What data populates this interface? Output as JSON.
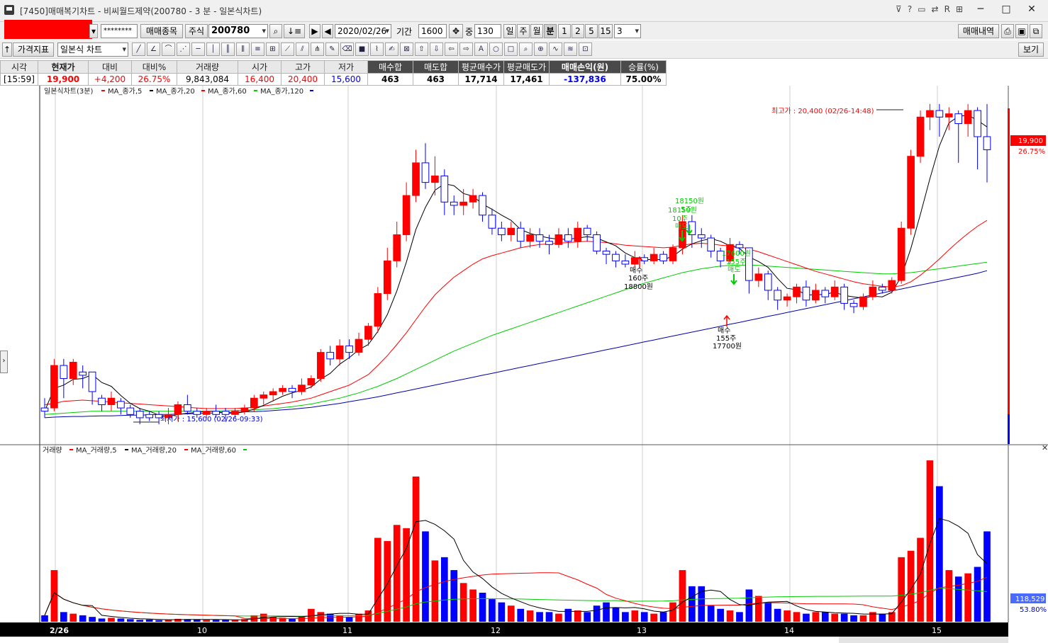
{
  "window": {
    "title": "[7450]매매복기차트 - 비씨월드제약(200780 - 3 분 - 일본식차트)",
    "icons": [
      "?",
      "R"
    ],
    "buttons": [
      "─",
      "□",
      "✕"
    ]
  },
  "toolbar": {
    "account_mask": "********",
    "trade_items_label": "매매종목",
    "market_label": "주식",
    "code": "200780",
    "date": "2020/02/26",
    "period_label": "기간",
    "period_value": "1600",
    "mid_label": "중",
    "mid_value": "130",
    "period_tabs": [
      "일",
      "주",
      "월",
      "분",
      "1",
      "2",
      "5",
      "15"
    ],
    "interval_value": "3",
    "trade_history_label": "매매내역",
    "price_indicator_label": "가격지표",
    "chart_type": "일본식 차트",
    "view_label": "보기"
  },
  "info": {
    "headers": [
      "시각",
      "현재가",
      "대비",
      "대비%",
      "거래량",
      "시가",
      "고가",
      "저가",
      "매수합",
      "매도합",
      "평균매수가",
      "평균매도가",
      "매매손익(원)",
      "승률(%)"
    ],
    "values": [
      "[15:59]",
      "19,900",
      "+4,200",
      "26.75%",
      "9,843,084",
      "16,400",
      "20,400",
      "15,600",
      "463",
      "463",
      "17,714",
      "17,461",
      "-137,836",
      "75.00%"
    ]
  },
  "price_legend": [
    "일본식차트(3분)",
    "MA_종가,5",
    "MA_종가,20",
    "MA_종가,60",
    "MA_종가,120"
  ],
  "volume_legend": [
    "거래량",
    "MA_거래량,5",
    "MA_거래량,20",
    "MA_거래량,60"
  ],
  "annotations": {
    "high": "최고가 : 20,400 (02/26-14:48)",
    "low": "최저가 : 15,600 (02/26-09:33)",
    "buy1": [
      "매수",
      "160주",
      "18800원"
    ],
    "buy2": [
      "매수",
      "155주",
      "17700원"
    ],
    "sell1": [
      "18150원",
      "5주",
      "18150원",
      "10주",
      "매도"
    ],
    "sell2": [
      "17600원",
      "155주",
      "매도"
    ]
  },
  "price_tag": [
    "19,900",
    "26.75%"
  ],
  "volume_tag": [
    "118,529",
    "53.80%"
  ],
  "x_labels": [
    "2/26",
    "10",
    "11",
    "12",
    "13",
    "14",
    "15"
  ],
  "colors": {
    "up": "#ff0000",
    "down": "#0000ff",
    "ma5": "#000000",
    "ma20": "#ff0000",
    "ma60": "#00cc00",
    "ma120": "#0000aa"
  },
  "chart_data": {
    "type": "candlestick",
    "interval": "3분",
    "high": 20400,
    "low": 15600,
    "candles": [
      [
        15750,
        15700,
        15900,
        15600
      ],
      [
        15750,
        16400,
        16500,
        15700
      ],
      [
        16400,
        16200,
        16500,
        15900
      ],
      [
        16200,
        16450,
        16500,
        16100
      ],
      [
        16300,
        16250,
        16400,
        16050
      ],
      [
        16300,
        16000,
        16200,
        15800
      ],
      [
        15900,
        15800,
        15950,
        15700
      ],
      [
        15800,
        15900,
        16000,
        15700
      ],
      [
        15850,
        15750,
        15900,
        15650
      ],
      [
        15750,
        15650,
        15800,
        15600
      ],
      [
        15700,
        15600,
        15750,
        15500
      ],
      [
        15650,
        15600,
        15700,
        15550
      ],
      [
        15650,
        15600,
        15700,
        15500
      ],
      [
        15600,
        15650,
        15750,
        15500
      ],
      [
        15650,
        15800,
        15850,
        15550
      ],
      [
        15800,
        15700,
        15950,
        15650
      ],
      [
        15700,
        15650,
        15750,
        15600
      ],
      [
        15650,
        15700,
        15750,
        15600
      ],
      [
        15700,
        15650,
        15800,
        15600
      ],
      [
        15700,
        15650,
        15750,
        15550
      ],
      [
        15650,
        15700,
        15750,
        15600
      ],
      [
        15700,
        15750,
        15800,
        15650
      ],
      [
        15750,
        15900,
        15950,
        15700
      ],
      [
        15900,
        15950,
        16000,
        15800
      ],
      [
        15950,
        16000,
        16050,
        15850
      ],
      [
        16000,
        16050,
        16100,
        15950
      ],
      [
        16050,
        16000,
        16100,
        15900
      ],
      [
        16000,
        16100,
        16200,
        15950
      ],
      [
        16100,
        16200,
        16250,
        16050
      ],
      [
        16200,
        16600,
        16650,
        16150
      ],
      [
        16600,
        16500,
        16700,
        16400
      ],
      [
        16500,
        16700,
        16800,
        16400
      ],
      [
        16700,
        16600,
        16800,
        16500
      ],
      [
        16600,
        16800,
        16900,
        16550
      ],
      [
        16800,
        17000,
        17050,
        16700
      ],
      [
        17000,
        17500,
        17600,
        16900
      ],
      [
        17500,
        18000,
        18200,
        17400
      ],
      [
        18000,
        18400,
        18600,
        17900
      ],
      [
        18400,
        19000,
        19200,
        18300
      ],
      [
        19000,
        19500,
        19700,
        18900
      ],
      [
        19500,
        19200,
        19800,
        19100
      ],
      [
        19200,
        19300,
        19600,
        19000
      ],
      [
        19300,
        18900,
        19400,
        18700
      ],
      [
        18900,
        18850,
        19000,
        18700
      ],
      [
        18850,
        18900,
        19100,
        18700
      ],
      [
        18900,
        19000,
        19100,
        18800
      ],
      [
        19000,
        18700,
        19050,
        18600
      ],
      [
        18700,
        18500,
        18800,
        18400
      ],
      [
        18500,
        18400,
        18600,
        18300
      ],
      [
        18400,
        18500,
        18600,
        18300
      ],
      [
        18500,
        18300,
        18600,
        18200
      ],
      [
        18300,
        18400,
        18500,
        18200
      ],
      [
        18400,
        18300,
        18500,
        18200
      ],
      [
        18300,
        18250,
        18400,
        18100
      ],
      [
        18250,
        18400,
        18500,
        18200
      ],
      [
        18400,
        18300,
        18500,
        18200
      ],
      [
        18300,
        18500,
        18600,
        18200
      ],
      [
        18500,
        18400,
        18550,
        18300
      ],
      [
        18400,
        18150,
        18450,
        18100
      ],
      [
        18150,
        18100,
        18200,
        17950
      ],
      [
        18100,
        18000,
        18150,
        17900
      ],
      [
        18000,
        17950,
        18100,
        17900
      ],
      [
        17950,
        18050,
        18150,
        17900
      ],
      [
        18050,
        18000,
        18100,
        17950
      ],
      [
        18000,
        18100,
        18200,
        17950
      ],
      [
        18100,
        18000,
        18150,
        17950
      ],
      [
        18000,
        18200,
        18250,
        17950
      ],
      [
        18200,
        18600,
        18700,
        18100
      ],
      [
        18600,
        18400,
        18700,
        18200
      ],
      [
        18400,
        18350,
        18500,
        18200
      ],
      [
        18350,
        18150,
        18400,
        18050
      ],
      [
        18150,
        18000,
        18200,
        17900
      ],
      [
        18000,
        18250,
        18350,
        17950
      ],
      [
        18250,
        18200,
        18300,
        18100
      ],
      [
        18200,
        17700,
        18200,
        17500
      ],
      [
        17700,
        17800,
        17900,
        17600
      ],
      [
        17800,
        17550,
        17850,
        17400
      ],
      [
        17550,
        17400,
        17600,
        17250
      ],
      [
        17400,
        17450,
        17500,
        17300
      ],
      [
        17450,
        17600,
        17650,
        17350
      ],
      [
        17600,
        17400,
        17700,
        17300
      ],
      [
        17400,
        17550,
        17650,
        17350
      ],
      [
        17550,
        17450,
        17600,
        17350
      ],
      [
        17450,
        17600,
        17700,
        17400
      ],
      [
        17600,
        17350,
        17650,
        17250
      ],
      [
        17350,
        17300,
        17400,
        17200
      ],
      [
        17300,
        17450,
        17500,
        17250
      ],
      [
        17450,
        17600,
        17700,
        17400
      ],
      [
        17600,
        17550,
        17650,
        17500
      ],
      [
        17550,
        17700,
        17750,
        17500
      ],
      [
        17700,
        18500,
        18600,
        17650
      ],
      [
        18500,
        19600,
        19700,
        18400
      ],
      [
        19600,
        20200,
        20300,
        19500
      ],
      [
        20200,
        20300,
        20400,
        20000
      ],
      [
        20300,
        20200,
        20400,
        19900
      ],
      [
        20200,
        20250,
        20350,
        20000
      ],
      [
        20250,
        20100,
        20300,
        19500
      ],
      [
        20100,
        20300,
        20400,
        19900
      ],
      [
        20300,
        19900,
        20350,
        19400
      ],
      [
        19900,
        19700,
        20400,
        19200
      ]
    ],
    "volume_max": 5200000,
    "volumes": [
      200000,
      1600000,
      300000,
      250000,
      200000,
      150000,
      100000,
      120000,
      100000,
      80000,
      60000,
      70000,
      50000,
      60000,
      90000,
      80000,
      70000,
      60000,
      60000,
      60000,
      60000,
      80000,
      200000,
      250000,
      150000,
      120000,
      100000,
      150000,
      400000,
      300000,
      250000,
      200000,
      150000,
      250000,
      350000,
      2600000,
      2500000,
      3000000,
      2900000,
      4500000,
      2800000,
      1900000,
      2000000,
      1600000,
      1200000,
      1000000,
      900000,
      700000,
      600000,
      500000,
      400000,
      350000,
      300000,
      300000,
      250000,
      400000,
      350000,
      300000,
      500000,
      600000,
      450000,
      300000,
      350000,
      300000,
      250000,
      300000,
      600000,
      1600000,
      1100000,
      1100000,
      500000,
      400000,
      350000,
      300000,
      1000000,
      800000,
      600000,
      400000,
      350000,
      300000,
      250000,
      300000,
      300000,
      250000,
      250000,
      200000,
      200000,
      300000,
      250000,
      300000,
      2000000,
      2200000,
      2600000,
      5000000,
      4200000,
      1600000,
      1400000,
      1500000,
      1700000,
      2800000
    ],
    "ma20_price": [
      15800,
      15820,
      15850,
      15860,
      15870,
      15860,
      15850,
      15840,
      15830,
      15820,
      15810,
      15800,
      15790,
      15780,
      15770,
      15760,
      15750,
      15740,
      15740,
      15740,
      15740,
      15750,
      15760,
      15780,
      15800,
      15820,
      15840,
      15870,
      15900,
      15950,
      16000,
      16050,
      16100,
      16180,
      16260,
      16400,
      16550,
      16720,
      16900,
      17100,
      17300,
      17480,
      17620,
      17750,
      17850,
      17950,
      18030,
      18080,
      18120,
      18160,
      18200,
      18230,
      18250,
      18260,
      18270,
      18280,
      18290,
      18300,
      18290,
      18280,
      18260,
      18240,
      18230,
      18220,
      18210,
      18200,
      18210,
      18240,
      18260,
      18270,
      18260,
      18240,
      18230,
      18220,
      18180,
      18140,
      18090,
      18040,
      17990,
      17940,
      17890,
      17840,
      17800,
      17760,
      17720,
      17680,
      17650,
      17630,
      17610,
      17600,
      17620,
      17680,
      17780,
      17900,
      18030,
      18170,
      18300,
      18420,
      18530,
      18620
    ],
    "ma60_price": [
      15650,
      15660,
      15670,
      15680,
      15690,
      15700,
      15700,
      15700,
      15700,
      15700,
      15700,
      15700,
      15700,
      15700,
      15700,
      15700,
      15700,
      15700,
      15700,
      15705,
      15710,
      15715,
      15720,
      15730,
      15740,
      15755,
      15770,
      15790,
      15810,
      15840,
      15870,
      15900,
      15940,
      15980,
      16030,
      16080,
      16140,
      16200,
      16270,
      16340,
      16410,
      16480,
      16550,
      16620,
      16680,
      16740,
      16800,
      16860,
      16910,
      16960,
      17010,
      17060,
      17110,
      17160,
      17210,
      17260,
      17310,
      17360,
      17410,
      17460,
      17510,
      17560,
      17610,
      17660,
      17700,
      17740,
      17780,
      17820,
      17850,
      17880,
      17900,
      17920,
      17930,
      17935,
      17935,
      17930,
      17920,
      17910,
      17900,
      17890,
      17880,
      17870,
      17860,
      17850,
      17840,
      17830,
      17820,
      17810,
      17800,
      17800,
      17810,
      17820,
      17840,
      17860,
      17880,
      17900,
      17920,
      17940,
      17960,
      17980
    ],
    "ma120_price": [
      15600,
      15610,
      15615,
      15620,
      15620,
      15625,
      15630,
      15630,
      15635,
      15640,
      15640,
      15645,
      15650,
      15650,
      15655,
      15660,
      15665,
      15670,
      15675,
      15680,
      15685,
      15690,
      15695,
      15700,
      15710,
      15720,
      15730,
      15745,
      15760,
      15780,
      15800,
      15820,
      15845,
      15870,
      15895,
      15920,
      15950,
      15980,
      16010,
      16040,
      16070,
      16100,
      16130,
      16160,
      16190,
      16220,
      16250,
      16280,
      16310,
      16340,
      16370,
      16400,
      16430,
      16460,
      16490,
      16520,
      16550,
      16580,
      16610,
      16640,
      16670,
      16700,
      16730,
      16760,
      16790,
      16820,
      16850,
      16880,
      16910,
      16940,
      16970,
      17000,
      17030,
      17060,
      17090,
      17120,
      17150,
      17180,
      17210,
      17240,
      17270,
      17300,
      17330,
      17360,
      17390,
      17420,
      17450,
      17480,
      17510,
      17540,
      17570,
      17600,
      17630,
      17660,
      17690,
      17720,
      17750,
      17780,
      17810,
      17850
    ]
  }
}
